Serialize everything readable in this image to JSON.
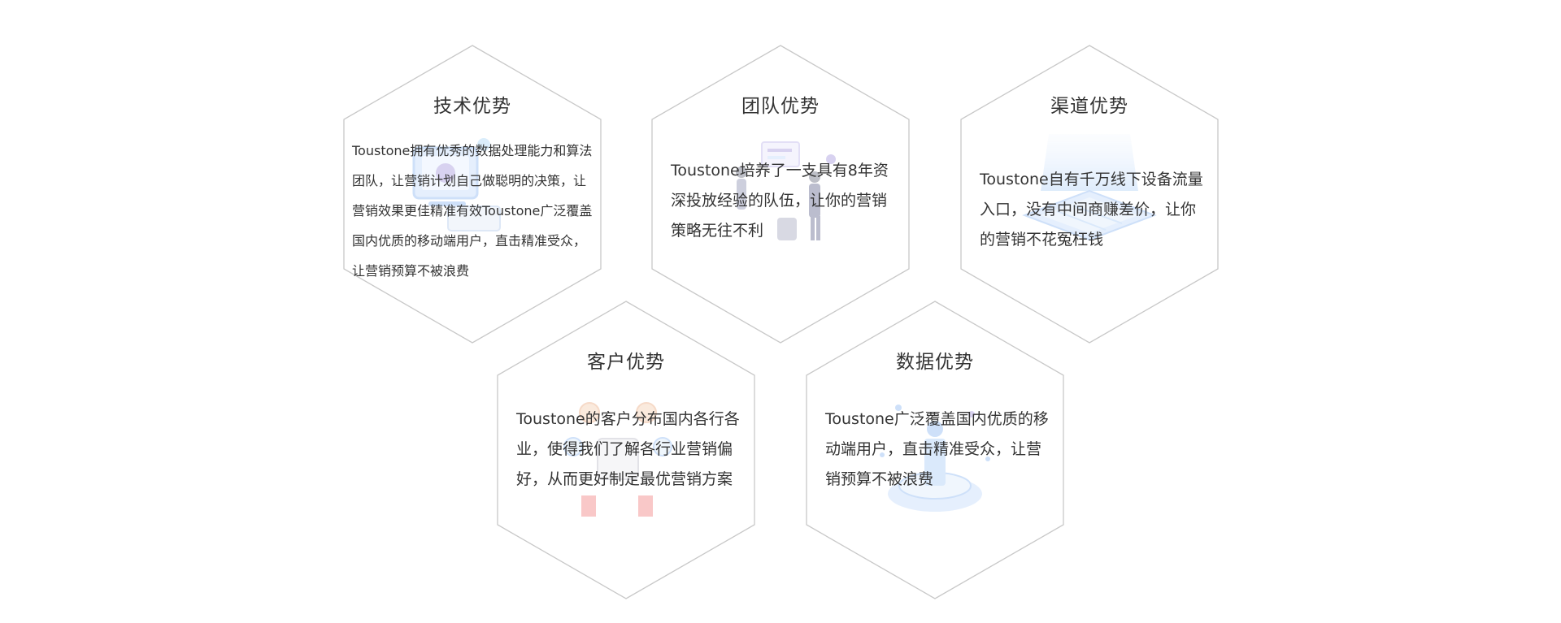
{
  "advantages": [
    {
      "title": "技术优势",
      "text": "Toustone拥有优秀的数据处理能力和算法团队，让营销计划自己做聪明的决策，让营销效果更佳精准有效Toustone广泛覆盖国内优质的移动端用户，直击精准受众，让营销预算不被浪费"
    },
    {
      "title": "团队优势",
      "text": "Toustone培养了一支具有8年资深投放经验的队伍，让你的营销策略无往不利"
    },
    {
      "title": "渠道优势",
      "text": "Toustone自有千万线下设备流量入口，没有中间商赚差价，让你的营销不花冤枉钱"
    },
    {
      "title": "客户优势",
      "text": "Toustone的客户分布国内各行各业，使得我们了解各行业营销偏好，从而更好制定最优营销方案"
    },
    {
      "title": "数据优势",
      "text": "Toustone广泛覆盖国内优质的移动端用户，直击精准受众，让营销预算不被浪费"
    }
  ],
  "colors": {
    "border": "#c8c8c8",
    "text": "#333333",
    "illustration_blue": "#7fb0f0",
    "illustration_purple": "#9a8cd8"
  },
  "icons": [
    "tech-illustration-icon",
    "team-illustration-icon",
    "channel-illustration-icon",
    "customer-illustration-icon",
    "data-illustration-icon"
  ]
}
